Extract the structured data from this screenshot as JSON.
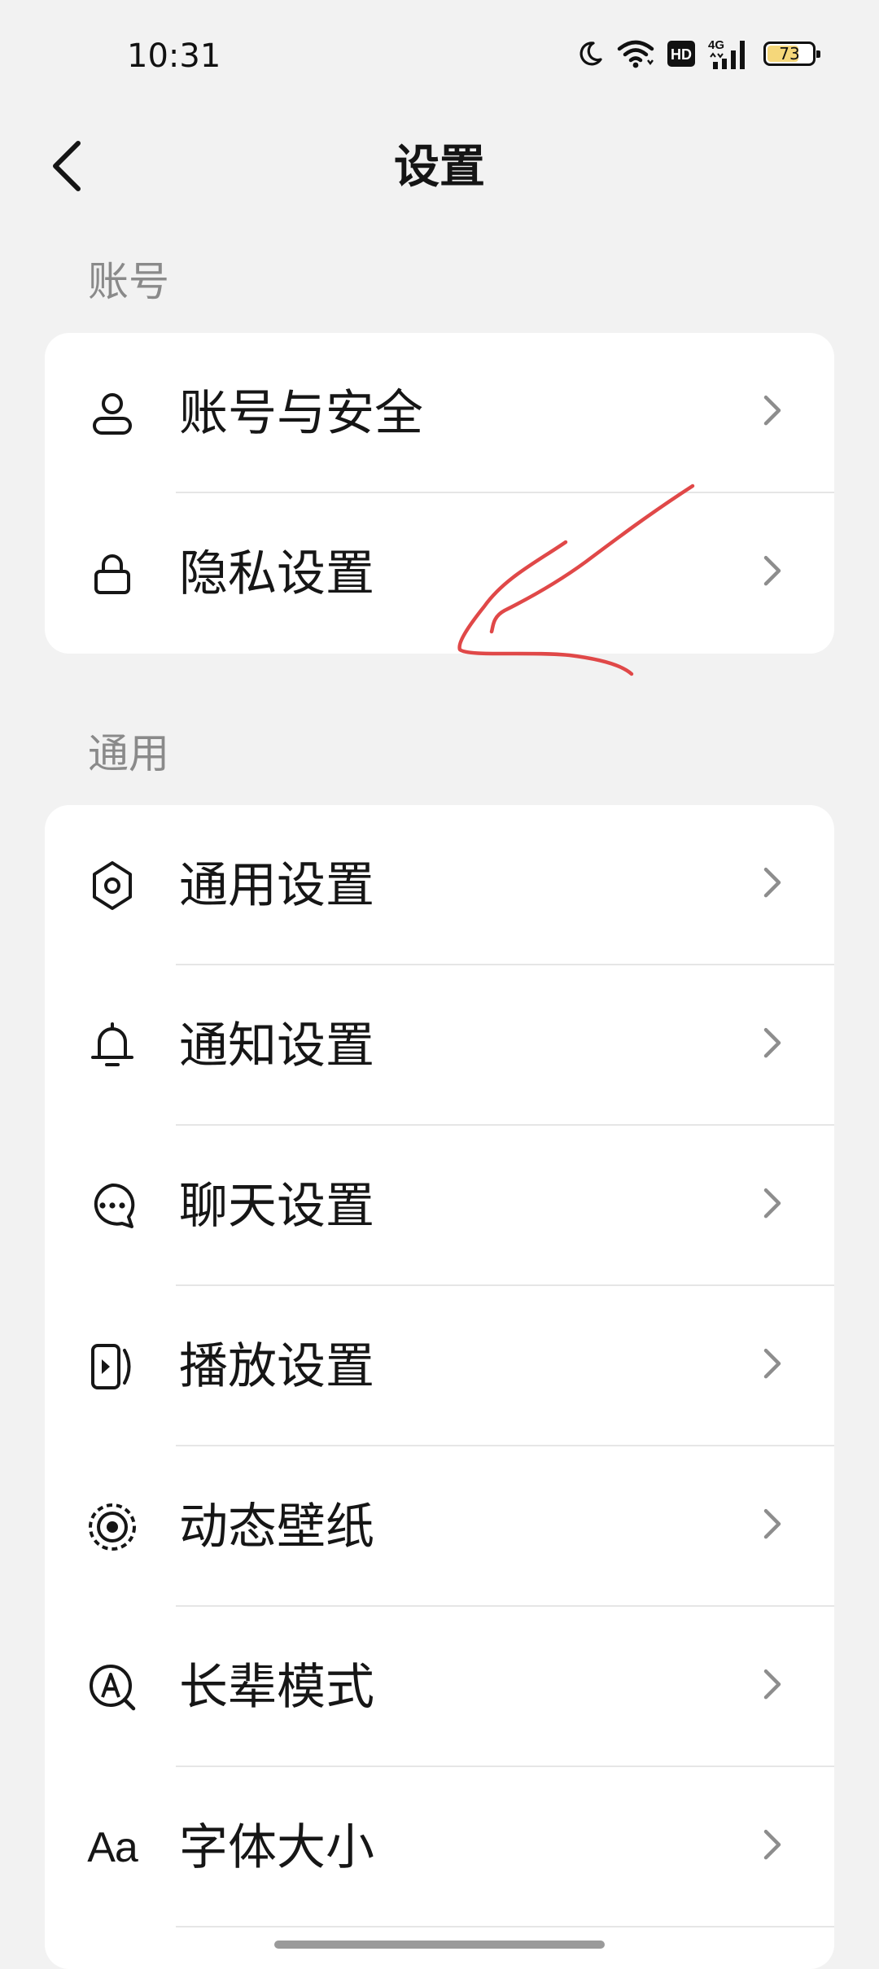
{
  "status_bar": {
    "time": "10:31",
    "icons": [
      "moon-icon",
      "wifi-icon",
      "hd-icon",
      "4g-signal-icon",
      "battery-icon"
    ],
    "hd_label": "HD",
    "network_label": "4G",
    "battery_level": "73",
    "battery_color": "#f5d77a"
  },
  "nav": {
    "title": "设置"
  },
  "sections": [
    {
      "header": "账号",
      "items": [
        {
          "label": "账号与安全",
          "icon": "user-icon"
        },
        {
          "label": "隐私设置",
          "icon": "lock-icon"
        }
      ]
    },
    {
      "header": "通用",
      "items": [
        {
          "label": "通用设置",
          "icon": "gear-icon"
        },
        {
          "label": "通知设置",
          "icon": "bell-icon"
        },
        {
          "label": "聊天设置",
          "icon": "chat-bubble-icon"
        },
        {
          "label": "播放设置",
          "icon": "play-settings-icon"
        },
        {
          "label": "动态壁纸",
          "icon": "live-wallpaper-icon"
        },
        {
          "label": "长辈模式",
          "icon": "elder-mode-icon"
        },
        {
          "label": "字体大小",
          "icon": "font-size-icon",
          "icon_text": "Aa"
        }
      ]
    }
  ],
  "annotation_color": "#e04848"
}
